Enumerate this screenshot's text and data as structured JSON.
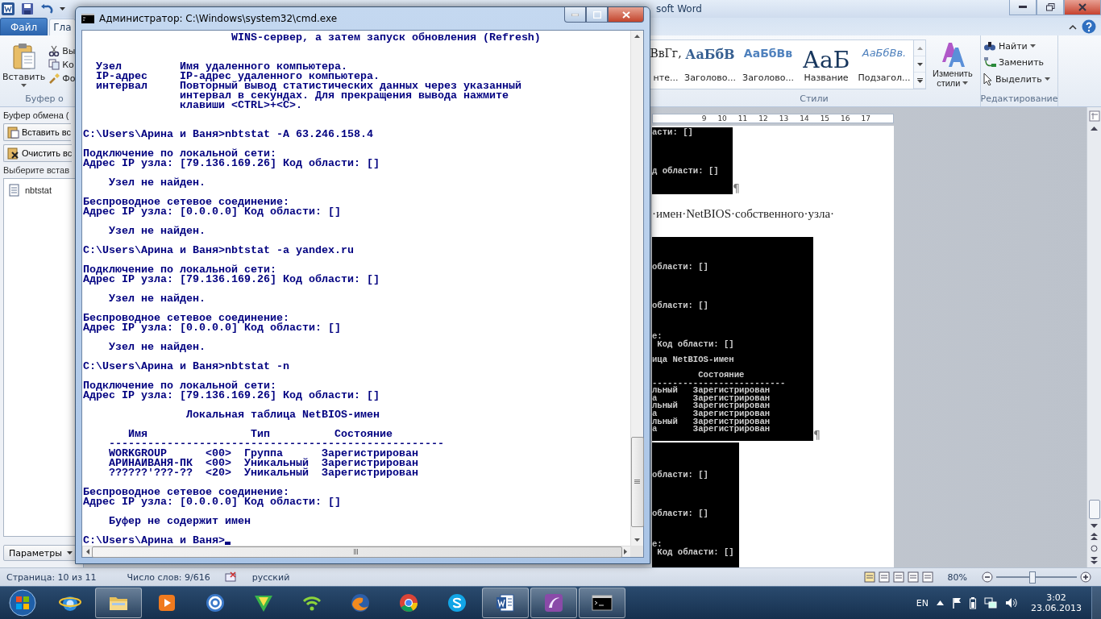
{
  "word": {
    "title": "soft Word",
    "tabs": [
      {
        "label": "Файл",
        "kind": "file",
        "selected": false
      },
      {
        "label": "Гла",
        "kind": "tab",
        "selected": true
      }
    ],
    "clipboard_group": {
      "paste": "Вставить",
      "items": [
        {
          "kind": "cut",
          "label": "Вы"
        },
        {
          "kind": "copy",
          "label": "Ко"
        },
        {
          "kind": "format",
          "label": "Фо"
        }
      ],
      "label": "Буфер о"
    },
    "styles": [
      {
        "kind": "normal",
        "preview": "ВвГг,",
        "name": "нте..."
      },
      {
        "kind": "heading1",
        "preview": "АаБбВ",
        "name": "Заголово..."
      },
      {
        "kind": "heading2",
        "preview": "АаБбВв",
        "name": "Заголово..."
      },
      {
        "kind": "title",
        "preview": "АаБ",
        "name": "Название"
      },
      {
        "kind": "subtitle",
        "preview": "АаБбВв.",
        "name": "Подзагол..."
      }
    ],
    "change_styles": [
      "Изменить",
      "стили"
    ],
    "styles_label": "Стили",
    "editing": [
      {
        "kind": "find",
        "label": "Найти",
        "dropdown": true
      },
      {
        "kind": "replace",
        "label": "Заменить",
        "dropdown": false
      },
      {
        "kind": "select",
        "label": "Выделить",
        "dropdown": true
      }
    ],
    "editing_label": "Редактирование",
    "clipboard_pane": {
      "title": "Буфер обмена (",
      "buttons": [
        {
          "kind": "paste",
          "label": "Вставить вс"
        },
        {
          "kind": "clear",
          "label": "Очистить вс"
        }
      ],
      "hint": "Выберите встав",
      "items": [
        "nbtstat"
      ],
      "options": "Параметры"
    },
    "ruler": [
      "9",
      "10",
      "11",
      "12",
      "13",
      "14",
      "15",
      "16",
      "17"
    ],
    "document": [
      {
        "kind": "image",
        "text": "асти: []\n\n\n\n\nд области: []",
        "end_mark": "¶"
      },
      {
        "kind": "paragraph",
        "text": "·имен·NetBIOS·собственного·узла·"
      },
      {
        "kind": "image",
        "text": "\n\n\nобласти: []\n\n\n\n\nобласти: []\n\n\n\nе:\n Код области: []\n\nица NetBIOS-имен\n\n         Состояние\n--------------------------\nльный   Зарегистрирован\nа       Зарегистрирован\nльный   Зарегистрирован\nа       Зарегистрирован\nльный   Зарегистрирован\nа       Зарегистрирован",
        "end_mark": "¶"
      },
      {
        "kind": "image",
        "text": "\n\n\nобласти: []\n\n\n\n\nобласти: []\n\n\n\nе:\n Код области: []"
      }
    ],
    "status": {
      "page": "Страница: 10 из 11",
      "words": "Число слов: 9/616",
      "language": "русский",
      "zoom": "80%",
      "zoom_level": {
        "level": 0.44
      }
    }
  },
  "console": {
    "title": "Администратор: C:\\Windows\\system32\\cmd.exe",
    "output": "                       WINS-сервер, а затем запуск обновления (Refresh)\n\n\n  Узел         Имя удаленного компьютера.\n  IP-адрес     IP-адрес удаленного компьютера.\n  интервал     Повторный вывод статистических данных через указанный\n               интервал в секундах. Для прекращения вывода нажмите\n               клавиши <CTRL>+<C>.\n\n\nC:\\Users\\Арина и Ваня>nbtstat -A 63.246.158.4\n\nПодключение по локальной сети:\nАдрес IP узла: [79.136.169.26] Код области: []\n\n    Узел не найден.\n\nБеспроводное сетевое соединение:\nАдрес IP узла: [0.0.0.0] Код области: []\n\n    Узел не найден.\n\nC:\\Users\\Арина и Ваня>nbtstat -a yandex.ru\n\nПодключение по локальной сети:\nАдрес IP узла: [79.136.169.26] Код области: []\n\n    Узел не найден.\n\nБеспроводное сетевое соединение:\nАдрес IP узла: [0.0.0.0] Код области: []\n\n    Узел не найден.\n\nC:\\Users\\Арина и Ваня>nbtstat -n\n\nПодключение по локальной сети:\nАдрес IP узла: [79.136.169.26] Код области: []\n\n                Локальная таблица NetBIOS-имен\n\n       Имя                Тип          Состояние\n    ----------------------------------------------------\n    WORKGROUP      <00>  Группа      Зарегистрирован\n    АРИНАИВАНЯ-ПК  <00>  Уникальный  Зарегистрирован\n    ??????'???-??  <20>  Уникальный  Зарегистрирован\n\nБеспроводное сетевое соединение:\nАдрес IP узла: [0.0.0.0] Код области: []\n\n    Буфер не содержит имен\n\nC:\\Users\\Арина и Ваня>"
  },
  "taskbar": {
    "apps": [
      {
        "kind": "browser-e",
        "running": false
      },
      {
        "kind": "folder",
        "running": true
      },
      {
        "kind": "media",
        "running": false
      },
      {
        "kind": "at",
        "running": false
      },
      {
        "kind": "triangle",
        "running": false
      },
      {
        "kind": "wifi",
        "running": false
      },
      {
        "kind": "fox",
        "running": false
      },
      {
        "kind": "chrome",
        "running": false
      },
      {
        "kind": "skype",
        "running": false
      },
      {
        "kind": "word",
        "running": true
      },
      {
        "kind": "swirl",
        "running": true
      },
      {
        "kind": "console",
        "running": true
      }
    ],
    "language": "EN",
    "time": "3:02",
    "date": "23.06.2013"
  }
}
